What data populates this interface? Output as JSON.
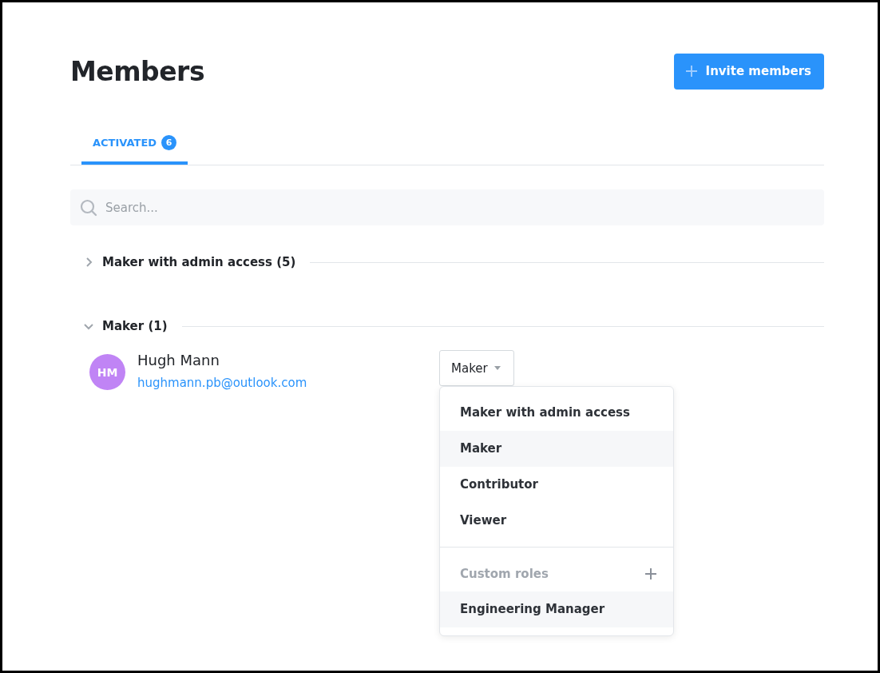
{
  "page": {
    "title": "Members"
  },
  "invite_button": {
    "label": "Invite members"
  },
  "tabs": [
    {
      "label": "ACTIVATED",
      "count": "6",
      "selected": true
    }
  ],
  "search": {
    "placeholder": "Search..."
  },
  "groups": [
    {
      "label": "Maker with admin access (5)",
      "expanded": false
    },
    {
      "label": "Maker (1)",
      "expanded": true,
      "members": [
        {
          "initials": "HM",
          "color": "#c084f5",
          "name": "Hugh Mann",
          "email": "hughmann.pb@outlook.com",
          "role": "Maker",
          "menu_open": true
        }
      ]
    }
  ],
  "role_menu": {
    "items": [
      {
        "label": "Maker with admin access",
        "highlighted": false
      },
      {
        "label": "Maker",
        "highlighted": true
      },
      {
        "label": "Contributor",
        "highlighted": false
      },
      {
        "label": "Viewer",
        "highlighted": false
      }
    ],
    "custom_header": "Custom roles",
    "custom_items": [
      {
        "label": "Engineering Manager",
        "highlighted": true
      }
    ]
  }
}
